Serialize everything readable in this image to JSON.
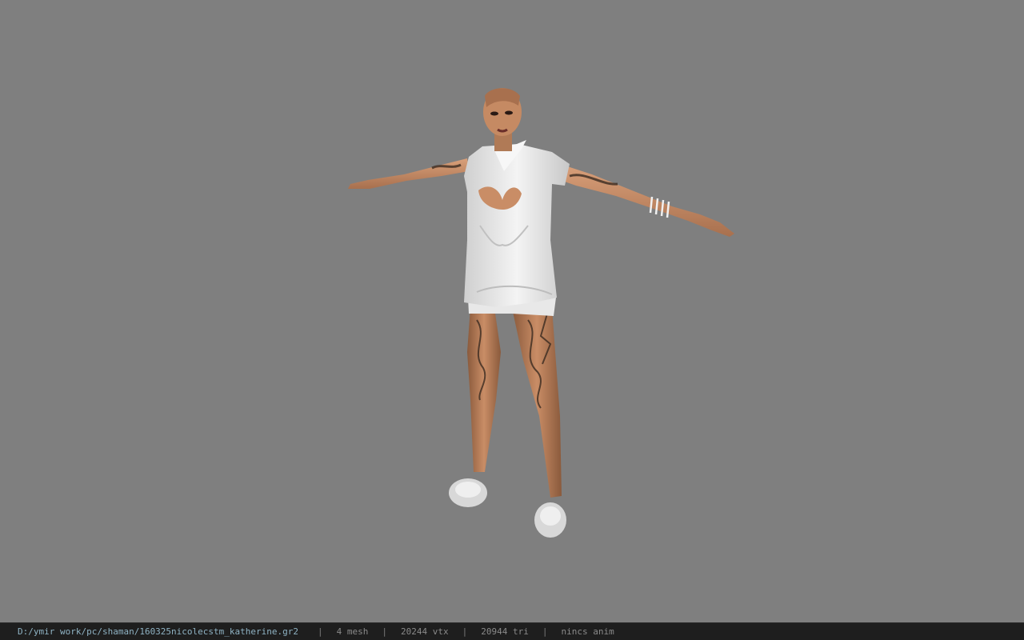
{
  "viewer": {
    "background": "#7f7f7f",
    "model_icon": "character-model"
  },
  "status": {
    "file_path": "D:/ymir work/pc/shaman/160325nicolecstm_katherine.gr2",
    "mesh": "4 mesh",
    "vtx": "20244 vtx",
    "tri": "20944 tri",
    "anim": "nincs anim",
    "separator": "|"
  },
  "colors": {
    "status_bg": "#1e1e1e",
    "path_color": "#8fb3c4",
    "stat_color": "#8a8a8a"
  }
}
